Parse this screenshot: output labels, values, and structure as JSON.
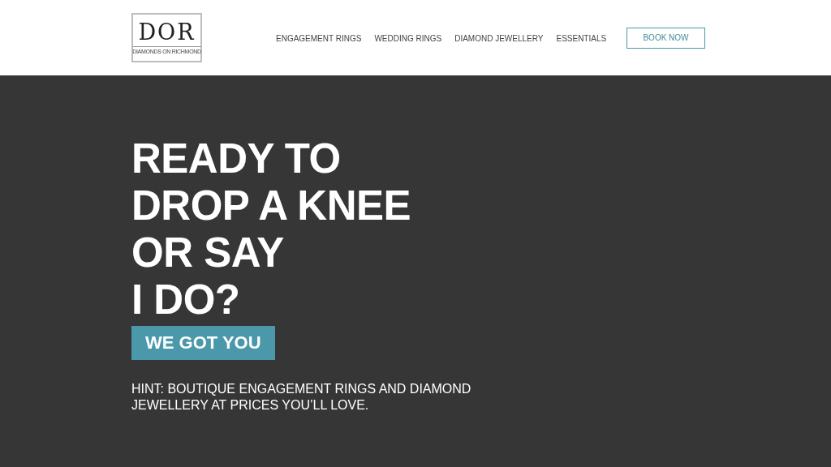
{
  "header": {
    "logo": {
      "mark": "DOR",
      "tagline": "DIAMONDS ON RICHMOND"
    },
    "nav": [
      "ENGAGEMENT RINGS",
      "WEDDING RINGS",
      "DIAMOND JEWELLERY",
      "ESSENTIALS"
    ],
    "cta": "BOOK NOW"
  },
  "hero": {
    "headline_lines": [
      "READY TO",
      "DROP A KNEE",
      "OR SAY",
      "I DO?"
    ],
    "badge": "WE GOT YOU",
    "hint": "HINT: BOUTIQUE ENGAGEMENT RINGS AND DIAMOND JEWELLERY AT PRICES YOU’LL LOVE."
  }
}
